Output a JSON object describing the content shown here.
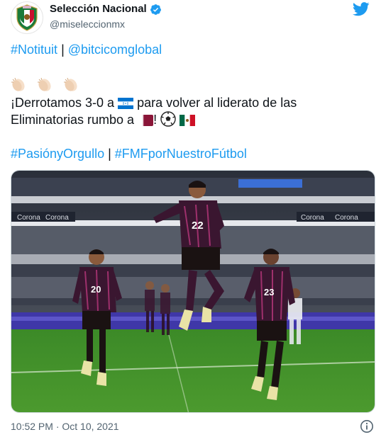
{
  "account": {
    "display_name": "Selección Nacional",
    "handle": "@miseleccionmx"
  },
  "tweet": {
    "line1": {
      "hashtag1": "#Notituit",
      "separator": "|",
      "mention": "@bitcicomglobal"
    },
    "claps": [
      "clapping-hands",
      "clapping-hands",
      "clapping-hands"
    ],
    "line3": {
      "prefix": "¡Derrotamos 3-0 a",
      "suffix": "para volver al liderato de las"
    },
    "line4": {
      "prefix": "Eliminatorias rumbo a",
      "mid": "!"
    },
    "line5": {
      "hashtag1": "#PasiónyOrgullo",
      "separator": "|",
      "hashtag2": "#FMFporNuestroFútbol"
    }
  },
  "photo": {
    "players": [
      {
        "number": "22"
      },
      {
        "number": "20"
      },
      {
        "number": "23"
      }
    ],
    "banners": [
      "Corona",
      "Corona",
      "Corona",
      "Corona"
    ]
  },
  "footer": {
    "timestamp": "10:52 PM · Oct 10, 2021"
  },
  "colors": {
    "link": "#1d9bf0",
    "text": "#0f1419",
    "muted": "#536471",
    "verified": "#1d9bf0",
    "jersey": "#3a1630",
    "jersey_stripe": "#c93b86",
    "pitch": "#3f8a2a"
  }
}
